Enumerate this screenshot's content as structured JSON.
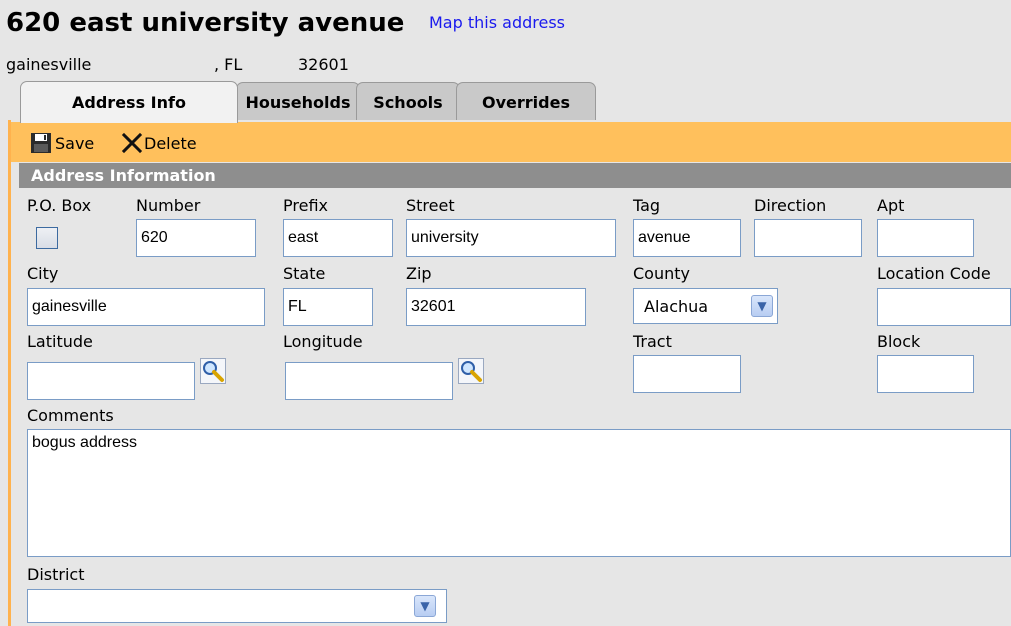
{
  "header": {
    "title": "620 east university avenue",
    "map_link": "Map this address",
    "city": "gainesville",
    "state": ", FL",
    "zip": "32601"
  },
  "tabs": [
    {
      "label": "Address Info",
      "active": true
    },
    {
      "label": "Households",
      "active": false
    },
    {
      "label": "Schools",
      "active": false
    },
    {
      "label": "Overrides",
      "active": false
    }
  ],
  "toolbar": {
    "save_label": "Save",
    "delete_label": "Delete"
  },
  "section": {
    "title": "Address Information"
  },
  "form": {
    "labels": {
      "po_box": "P.O. Box",
      "number": "Number",
      "prefix": "Prefix",
      "street": "Street",
      "tag": "Tag",
      "direction": "Direction",
      "apt": "Apt",
      "city": "City",
      "state": "State",
      "zip": "Zip",
      "county": "County",
      "location_code": "Location Code",
      "latitude": "Latitude",
      "longitude": "Longitude",
      "tract": "Tract",
      "block": "Block",
      "comments": "Comments",
      "district": "District"
    },
    "values": {
      "po_box_checked": false,
      "number": "620",
      "prefix": "east",
      "street": "university",
      "tag": "avenue",
      "direction": "",
      "apt": "",
      "city": "gainesville",
      "state": "FL",
      "zip": "32601",
      "county": "Alachua",
      "location_code": "",
      "latitude": "",
      "longitude": "",
      "tract": "",
      "block": "",
      "comments": "bogus address",
      "district": ""
    }
  },
  "icons": {
    "save": "floppy-disk-icon",
    "delete": "x-icon",
    "lookup": "magnifier-icon",
    "dropdown": "chevron-down-icon"
  },
  "colors": {
    "toolbar": "#ffc05c",
    "section_bar": "#8e8e8e",
    "link": "#1a1aee",
    "input_border": "#7a9cc6"
  }
}
